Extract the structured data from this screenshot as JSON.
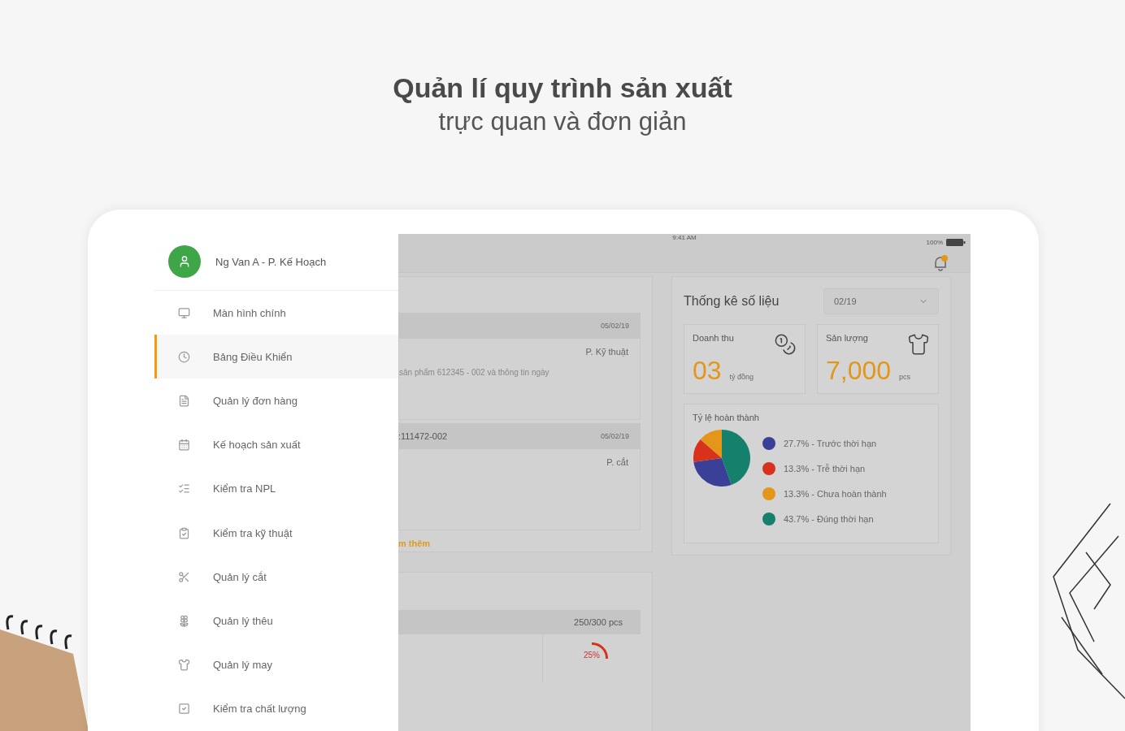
{
  "headline": {
    "title": "Quản lí quy trình sản xuất",
    "subtitle": "trực quan và đơn giản"
  },
  "status_bar": {
    "time": "9:41 AM",
    "battery": "100%"
  },
  "drawer": {
    "user": "Ng Van A - P. Kế Hoạch",
    "items": [
      {
        "label": "Màn hình chính",
        "selected": false
      },
      {
        "label": "Bảng Điều Khiển",
        "selected": true
      },
      {
        "label": "Quản lý đơn hàng",
        "selected": false
      },
      {
        "label": "Kế hoạch sản xuất",
        "selected": false
      },
      {
        "label": "Kiểm tra NPL",
        "selected": false
      },
      {
        "label": "Kiểm tra kỹ thuật",
        "selected": false
      },
      {
        "label": "Quản lý cắt",
        "selected": false
      },
      {
        "label": "Quản lý thêu",
        "selected": false
      },
      {
        "label": "Quản lý may",
        "selected": false
      },
      {
        "label": "Kiểm tra chất lượng",
        "selected": false
      }
    ]
  },
  "notifications": [
    {
      "date": "05/02/19",
      "department": "P. Kỹ thuật",
      "text": "sản phẩm 612345 - 002 và thông tin ngày"
    },
    {
      "header": ":111472-002",
      "date": "05/02/19",
      "department": "P. cắt"
    }
  ],
  "more_link": "m thêm",
  "progress": {
    "count": "250/300 pcs",
    "percent": "25%"
  },
  "stats": {
    "title": "Thống kê số liệu",
    "period": "02/19",
    "tiles": [
      {
        "label": "Doanh thu",
        "value": "03",
        "unit": "tỷ đồng"
      },
      {
        "label": "Sản lượng",
        "value": "7,000",
        "unit": "pcs"
      }
    ],
    "completion": {
      "title": "Tỷ lệ hoàn thành",
      "legend": [
        {
          "text": "27.7% - Trước thời hạn",
          "color": "#3a3f98"
        },
        {
          "text": "13.3% - Trễ thời hạn",
          "color": "#d8321c"
        },
        {
          "text": "13.3% - Chưa hoàn thành",
          "color": "#e3961a"
        },
        {
          "text": "43.7% - Đúng thời hạn",
          "color": "#15806c"
        }
      ],
      "chart_data": {
        "type": "pie",
        "values": [
          28.3,
          13.6,
          13.6,
          44.5
        ]
      }
    }
  }
}
